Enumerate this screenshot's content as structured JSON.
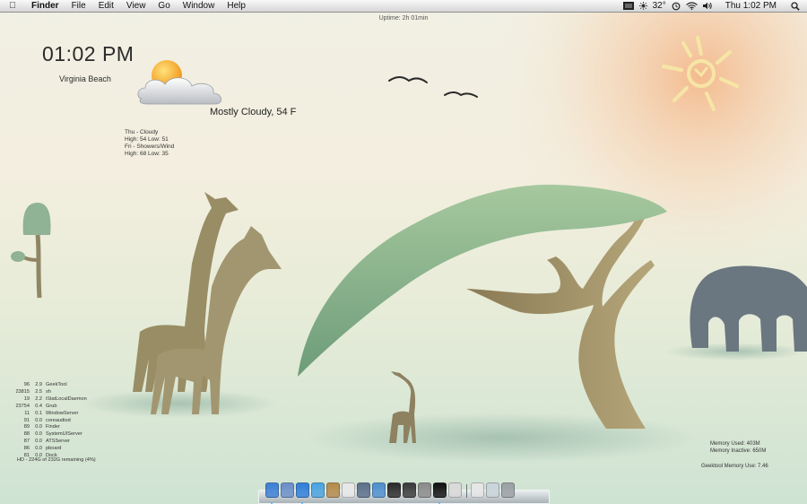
{
  "menubar": {
    "apple_icon": "apple-icon",
    "items": [
      "Finder",
      "File",
      "Edit",
      "View",
      "Go",
      "Window",
      "Help"
    ],
    "temperature": "32°",
    "clock": "Thu 1:02 PM",
    "status_icons": [
      "display-icon",
      "time-machine-icon",
      "wifi-icon",
      "volume-icon",
      "spotlight-icon"
    ]
  },
  "uptime": "Uptime: 2h 01min",
  "weather": {
    "time": "01:02 PM",
    "city": "Virginia Beach",
    "condition": "Mostly Cloudy, 54 F",
    "forecast": [
      "Thu - Cloudy",
      "High: 54 Low: 51",
      "Fri - Showers/Wind",
      "High: 68 Low: 35"
    ]
  },
  "processes": [
    {
      "pid": "96",
      "cpu": "2.9",
      "name": "GeekTool"
    },
    {
      "pid": "23815",
      "cpu": "2.5",
      "name": "sh"
    },
    {
      "pid": "19",
      "cpu": "2.2",
      "name": "iStatLocalDaemon"
    },
    {
      "pid": "23754",
      "cpu": "0.4",
      "name": "Grub"
    },
    {
      "pid": "11",
      "cpu": "0.1",
      "name": "WindowServer"
    },
    {
      "pid": "91",
      "cpu": "0.0",
      "name": "coreaudiod"
    },
    {
      "pid": "89",
      "cpu": "0.0",
      "name": "Finder"
    },
    {
      "pid": "88",
      "cpu": "0.0",
      "name": "SystemUIServer"
    },
    {
      "pid": "87",
      "cpu": "0.0",
      "name": "ATSServer"
    },
    {
      "pid": "86",
      "cpu": "0.0",
      "name": "pboard"
    },
    {
      "pid": "81",
      "cpu": "0.0",
      "name": "Dock"
    }
  ],
  "disk": "HD - 224G of 232G remaining (4%)",
  "memory": {
    "used": "Memory Used: 403M",
    "inactive": "Memory Inactive: 650M"
  },
  "geektool": "Geektool Memory Use: 7.46",
  "dock": {
    "items": [
      {
        "name": "finder-icon",
        "color": "#3d7fd6"
      },
      {
        "name": "mail-icon",
        "color": "#6a8fc8"
      },
      {
        "name": "safari-icon",
        "color": "#2f7ed8"
      },
      {
        "name": "ichat-icon",
        "color": "#4aa3e0"
      },
      {
        "name": "address-book-icon",
        "color": "#b58a4a"
      },
      {
        "name": "ical-icon",
        "color": "#e8e8e8"
      },
      {
        "name": "iphoto-icon",
        "color": "#5b6f8a"
      },
      {
        "name": "itunes-icon",
        "color": "#4f8fcf"
      },
      {
        "name": "photo-booth-icon",
        "color": "#2a2a2a"
      },
      {
        "name": "dvd-player-icon",
        "color": "#3a3a3a"
      },
      {
        "name": "system-preferences-icon",
        "color": "#8a8a8a"
      },
      {
        "name": "terminal-icon",
        "color": "#111111"
      },
      {
        "name": "preview-icon",
        "color": "#d9d9d9"
      }
    ],
    "right_items": [
      {
        "name": "documents-stack-icon",
        "color": "#e6e6e6"
      },
      {
        "name": "downloads-stack-icon",
        "color": "#c9d3da"
      },
      {
        "name": "trash-icon",
        "color": "#9aa0a4"
      }
    ]
  }
}
